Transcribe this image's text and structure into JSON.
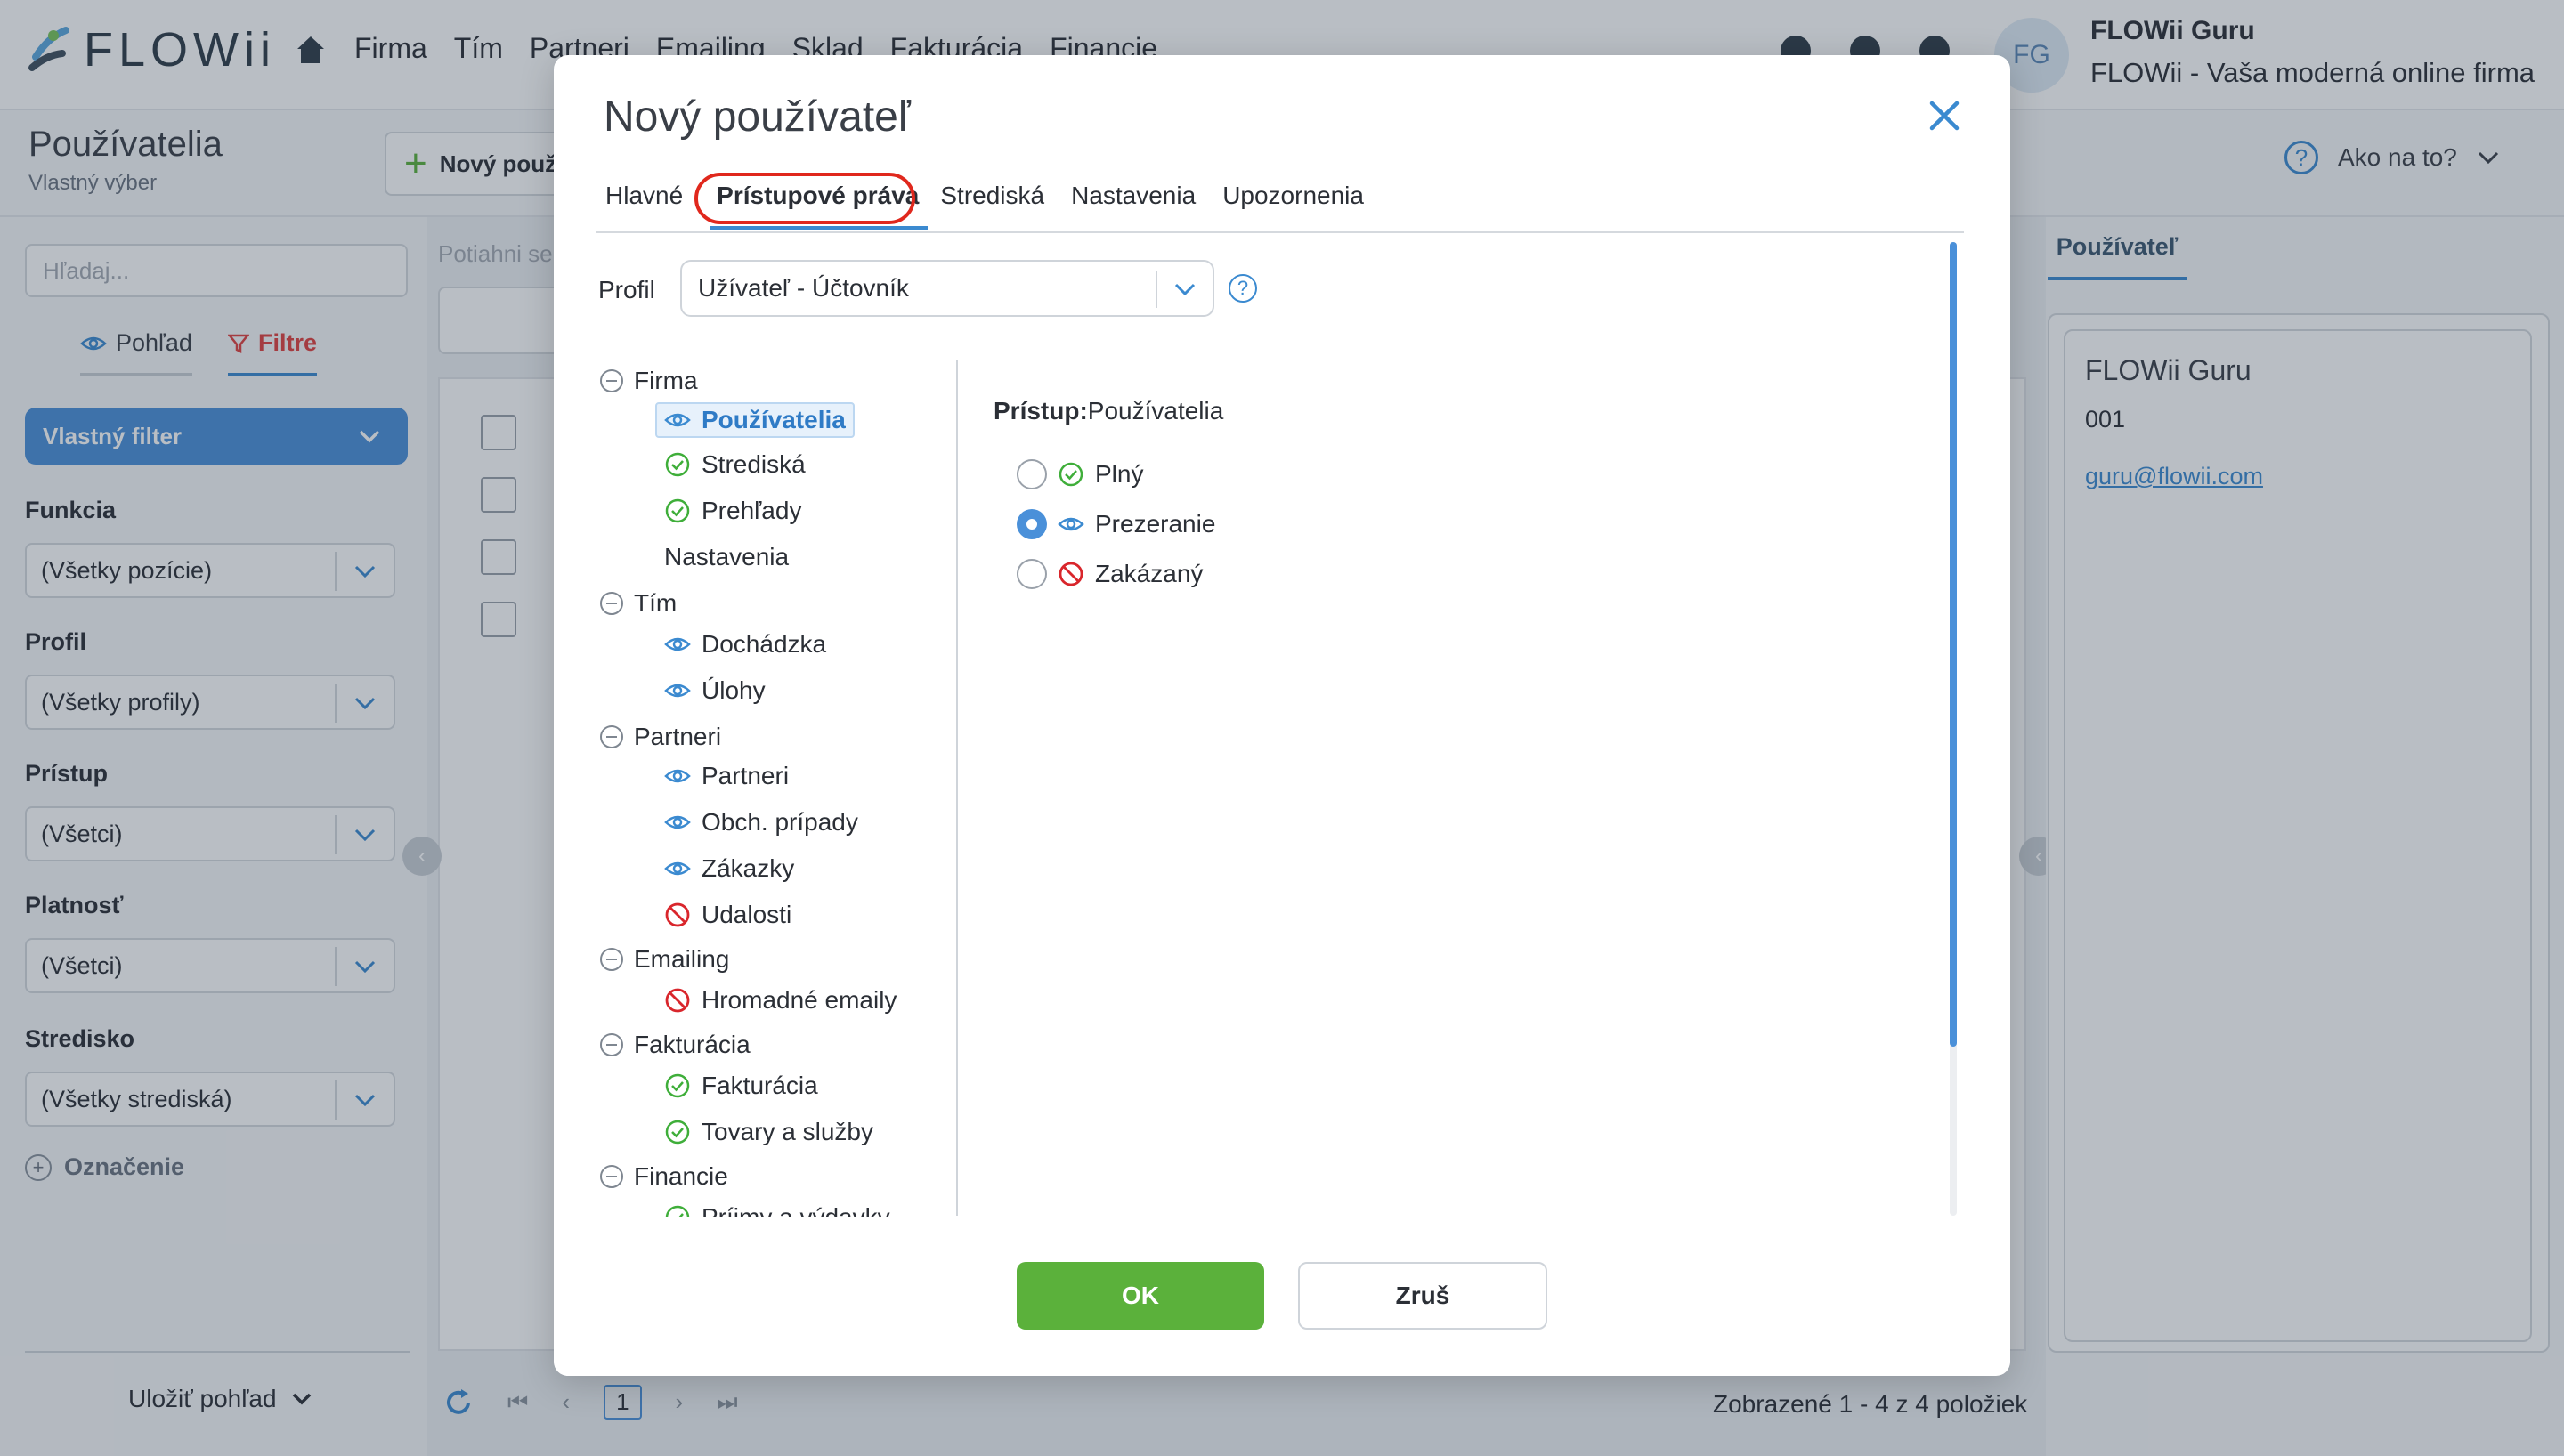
{
  "app": {
    "logo_text": "FLOWii",
    "nav": [
      "Firma",
      "Tím",
      "Partneri",
      "Emailing",
      "Sklad",
      "Fakturácia",
      "Financie"
    ],
    "user": {
      "initials": "FG",
      "name": "FLOWii Guru",
      "company": "FLOWii - Vaša moderná online firma"
    }
  },
  "page": {
    "title": "Používatelia",
    "subtitle": "Vlastný výber",
    "new_button": "Nový používateľ",
    "help": "Ako na to?",
    "drag_hint": "Potiahni sem",
    "count": "Zobrazené 1 - 4 z 4 položiek",
    "page_number": "1"
  },
  "left_panel": {
    "search_placeholder": "Hľadaj...",
    "tabs": {
      "view": "Pohľad",
      "filters": "Filtre"
    },
    "filter_button": "Vlastný filter",
    "filters": [
      {
        "label": "Funkcia",
        "value": "(Všetky pozície)"
      },
      {
        "label": "Profil",
        "value": "(Všetky profily)"
      },
      {
        "label": "Prístup",
        "value": "(Všetci)"
      },
      {
        "label": "Platnosť",
        "value": "(Všetci)"
      },
      {
        "label": "Stredisko",
        "value": "(Všetky strediská)"
      }
    ],
    "oznacenie": "Označenie",
    "save_view": "Uložiť pohľad"
  },
  "right_panel": {
    "tab": "Používateľ",
    "name": "FLOWii Guru",
    "code": "001",
    "email": "guru@flowii.com"
  },
  "modal": {
    "title": "Nový používateľ",
    "tabs": [
      "Hlavné",
      "Prístupové práva",
      "Strediská",
      "Nastavenia",
      "Upozornenia"
    ],
    "active_tab": "Prístupové práva",
    "profil_label": "Profil",
    "profil_value": "Užívateľ - Účtovník",
    "tree": [
      {
        "group": "Firma",
        "children": [
          {
            "label": "Používatelia",
            "icon": "eye-icon",
            "selected": true
          },
          {
            "label": "Strediská",
            "icon": "check-circle-icon"
          },
          {
            "label": "Prehľady",
            "icon": "check-circle-icon"
          },
          {
            "label": "Nastavenia",
            "icon": ""
          }
        ]
      },
      {
        "group": "Tím",
        "children": [
          {
            "label": "Dochádzka",
            "icon": "eye-icon"
          },
          {
            "label": "Úlohy",
            "icon": "eye-icon"
          }
        ]
      },
      {
        "group": "Partneri",
        "children": [
          {
            "label": "Partneri",
            "icon": "eye-icon"
          },
          {
            "label": "Obch. prípady",
            "icon": "eye-icon"
          },
          {
            "label": "Zákazky",
            "icon": "eye-icon"
          },
          {
            "label": "Udalosti",
            "icon": "forbidden-icon"
          }
        ]
      },
      {
        "group": "Emailing",
        "children": [
          {
            "label": "Hromadné emaily",
            "icon": "forbidden-icon"
          }
        ]
      },
      {
        "group": "Fakturácia",
        "children": [
          {
            "label": "Fakturácia",
            "icon": "check-circle-icon"
          },
          {
            "label": "Tovary a služby",
            "icon": "check-circle-icon"
          }
        ]
      },
      {
        "group": "Financie",
        "children": [
          {
            "label": "Príjmy a výdavky",
            "icon": "check-circle-icon"
          }
        ]
      }
    ],
    "access": {
      "prefix": "Prístup:",
      "module": "Používatelia",
      "options": [
        {
          "label": "Plný",
          "icon": "check-circle-icon",
          "checked": false
        },
        {
          "label": "Prezeranie",
          "icon": "eye-icon",
          "checked": true
        },
        {
          "label": "Zakázaný",
          "icon": "forbidden-icon",
          "checked": false
        }
      ]
    },
    "ok": "OK",
    "cancel": "Zruš"
  },
  "colors": {
    "accent": "#4a90d9",
    "ok_green": "#5bb13b",
    "allow_green": "#3fae3a",
    "deny_red": "#d9262c",
    "highlight_ring": "#e0281d"
  }
}
